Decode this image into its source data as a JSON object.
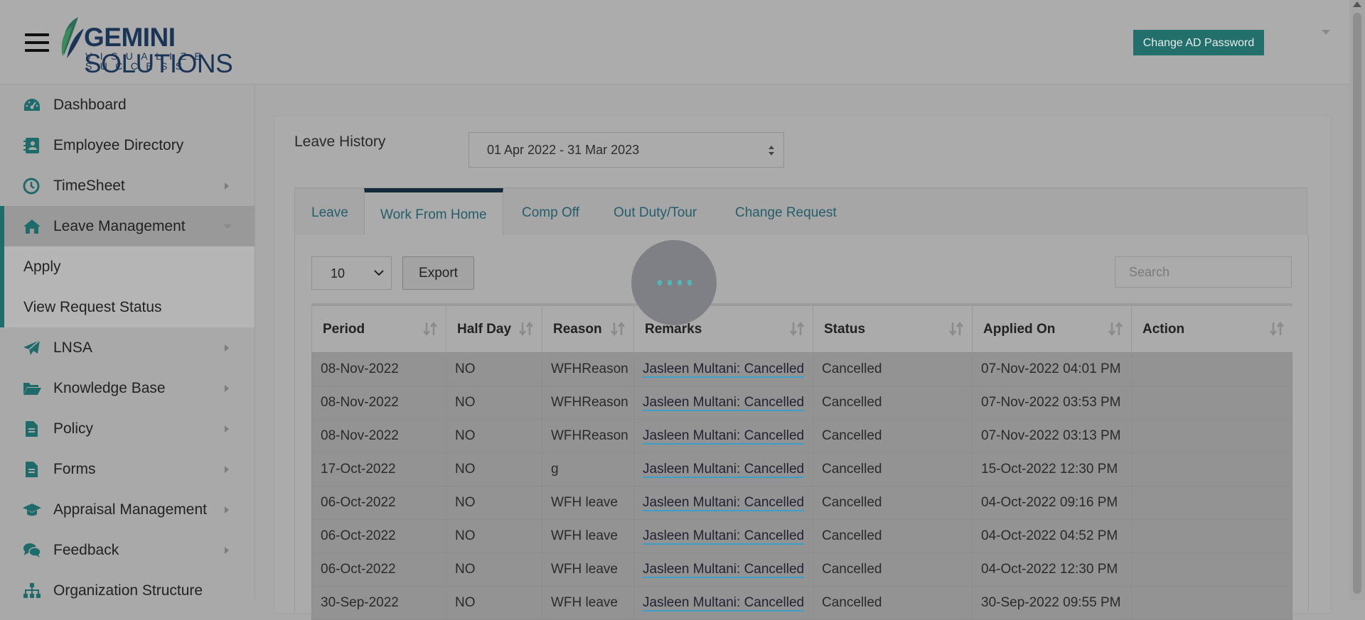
{
  "header": {
    "logo_word_bold": "GEMINI",
    "logo_word_light": "SOLUTIONS",
    "logo_tagline": "VISUALIZE SUCCESS",
    "change_password_label": "Change AD Password"
  },
  "sidebar": {
    "items": [
      {
        "label": "Dashboard",
        "icon": "dashboard-icon"
      },
      {
        "label": "Employee Directory",
        "icon": "contacts-book-icon"
      },
      {
        "label": "TimeSheet",
        "icon": "clock-icon"
      },
      {
        "label": "Leave Management",
        "icon": "home-icon"
      },
      {
        "label": "LNSA",
        "icon": "paper-plane-icon"
      },
      {
        "label": "Knowledge Base",
        "icon": "folder-open-icon"
      },
      {
        "label": "Policy",
        "icon": "document-icon"
      },
      {
        "label": "Forms",
        "icon": "document-icon"
      },
      {
        "label": "Appraisal Management",
        "icon": "graduation-cap-icon"
      },
      {
        "label": "Feedback",
        "icon": "chat-bubbles-icon"
      },
      {
        "label": "Organization Structure",
        "icon": "org-chart-icon"
      }
    ],
    "leave_submenu": [
      "Apply",
      "View Request Status"
    ]
  },
  "main": {
    "title": "Leave History",
    "date_range": "01 Apr 2022 - 31 Mar 2023",
    "tabs": [
      "Leave",
      "Work From Home",
      "Comp Off",
      "Out Duty/Tour",
      "Change Request"
    ],
    "active_tab": "Work From Home",
    "page_length": "10",
    "export_label": "Export",
    "search_placeholder": "Search"
  },
  "table": {
    "columns": [
      "Period",
      "Half Day",
      "Reason",
      "Remarks",
      "Status",
      "Applied On",
      "Action"
    ],
    "rows": [
      [
        "08-Nov-2022",
        "NO",
        "WFHReason",
        "Jasleen Multani: Cancelled",
        "Cancelled",
        "07-Nov-2022 04:01 PM",
        ""
      ],
      [
        "08-Nov-2022",
        "NO",
        "WFHReason",
        "Jasleen Multani: Cancelled",
        "Cancelled",
        "07-Nov-2022 03:53 PM",
        ""
      ],
      [
        "08-Nov-2022",
        "NO",
        "WFHReason",
        "Jasleen Multani: Cancelled",
        "Cancelled",
        "07-Nov-2022 03:13 PM",
        ""
      ],
      [
        "17-Oct-2022",
        "NO",
        "g",
        "Jasleen Multani: Cancelled",
        "Cancelled",
        "15-Oct-2022 12:30 PM",
        ""
      ],
      [
        "06-Oct-2022",
        "NO",
        "WFH leave",
        "Jasleen Multani: Cancelled",
        "Cancelled",
        "04-Oct-2022 09:16 PM",
        ""
      ],
      [
        "06-Oct-2022",
        "NO",
        "WFH leave",
        "Jasleen Multani: Cancelled",
        "Cancelled",
        "04-Oct-2022 04:52 PM",
        ""
      ],
      [
        "06-Oct-2022",
        "NO",
        "WFH leave",
        "Jasleen Multani: Cancelled",
        "Cancelled",
        "04-Oct-2022 12:30 PM",
        ""
      ],
      [
        "30-Sep-2022",
        "NO",
        "WFH leave",
        "Jasleen Multani: Cancelled",
        "Cancelled",
        "30-Sep-2022 09:55 PM",
        ""
      ]
    ]
  },
  "colors": {
    "accent_teal": "#236f6b",
    "link_teal": "#245e6b",
    "overlay_gray": "#a9a9a9"
  }
}
